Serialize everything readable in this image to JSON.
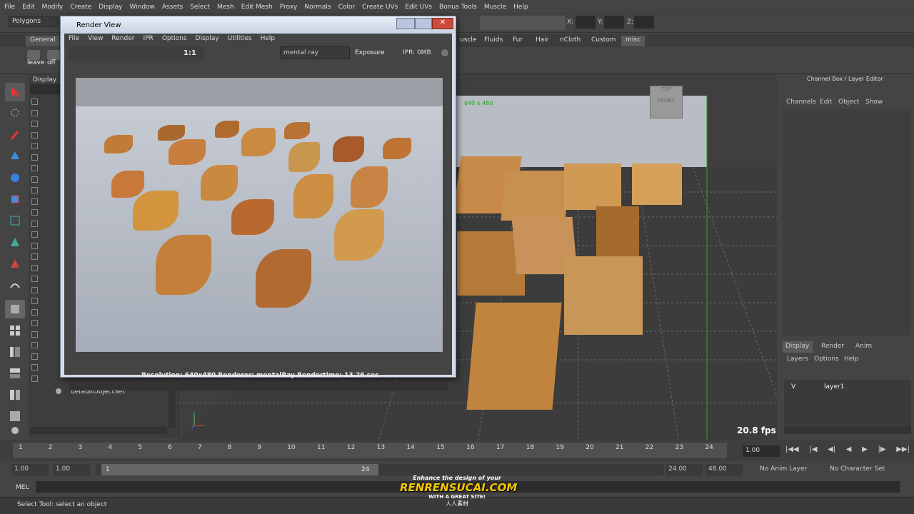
{
  "menubar": [
    "File",
    "Edit",
    "Modify",
    "Create",
    "Display",
    "Window",
    "Assets",
    "Select",
    "Mesh",
    "Edit Mesh",
    "Proxy",
    "Normals",
    "Color",
    "Create UVs",
    "Edit UVs",
    "Bonus Tools",
    "Muscle",
    "Help"
  ],
  "status": {
    "mode": "Polygons",
    "x_label": "X:",
    "y_label": "Y:",
    "z_label": "Z:"
  },
  "shelf_tabs": [
    "General",
    "uscle",
    "Fluids",
    "Fur",
    "Hair",
    "nCloth",
    "Custom",
    "misc"
  ],
  "shelf_buttons": [
    "leave",
    "off"
  ],
  "outliner": {
    "display": "Display",
    "item": "defaultObjectSet",
    "partial": "o defaultl..."
  },
  "viewport": {
    "resolution_gate": "640 x 480",
    "fps": "20.8 fps",
    "viewcube_top": "TOP",
    "viewcube_front": "FRONT"
  },
  "channel_box": {
    "title": "Channel Box / Layer Editor",
    "menu": [
      "Channels",
      "Edit",
      "Object",
      "Show"
    ],
    "tabs": [
      "Display",
      "Render",
      "Anim"
    ],
    "layer_menu": [
      "Layers",
      "Options",
      "Help"
    ],
    "layer_visible": "V",
    "layer_name": "layer1"
  },
  "render_view": {
    "title": "Render View",
    "menu": [
      "File",
      "View",
      "Render",
      "IPR",
      "Options",
      "Display",
      "Utilities",
      "Help"
    ],
    "ratio": "1:1",
    "renderer": "mental ray",
    "exposure_label": "Exposure",
    "ipr_label": "IPR: 0MB",
    "info": "Resolution: 640x480   Renderer: mentalRay   Rendertime: 13.26 sec"
  },
  "timeline": {
    "ticks": [
      "1",
      "2",
      "3",
      "4",
      "5",
      "6",
      "7",
      "8",
      "9",
      "10",
      "11",
      "12",
      "13",
      "14",
      "15",
      "16",
      "17",
      "18",
      "19",
      "20",
      "21",
      "22",
      "23",
      "24"
    ],
    "current": "1.00"
  },
  "range": {
    "start": "1.00",
    "start2": "1.00",
    "inner_start": "1",
    "inner_end": "24",
    "end": "24.00",
    "end2": "48.00",
    "anim_layer": "No Anim Layer",
    "char_set": "No Character Set"
  },
  "cmd": {
    "label": "MEL"
  },
  "help": {
    "text": "Select Tool: select an object"
  },
  "watermark": {
    "line1": "Enhance the design of your",
    "line2": "RENRENSUCAI.COM",
    "line3": "WITH A GREAT SITE!",
    "line4": "人人素材"
  }
}
